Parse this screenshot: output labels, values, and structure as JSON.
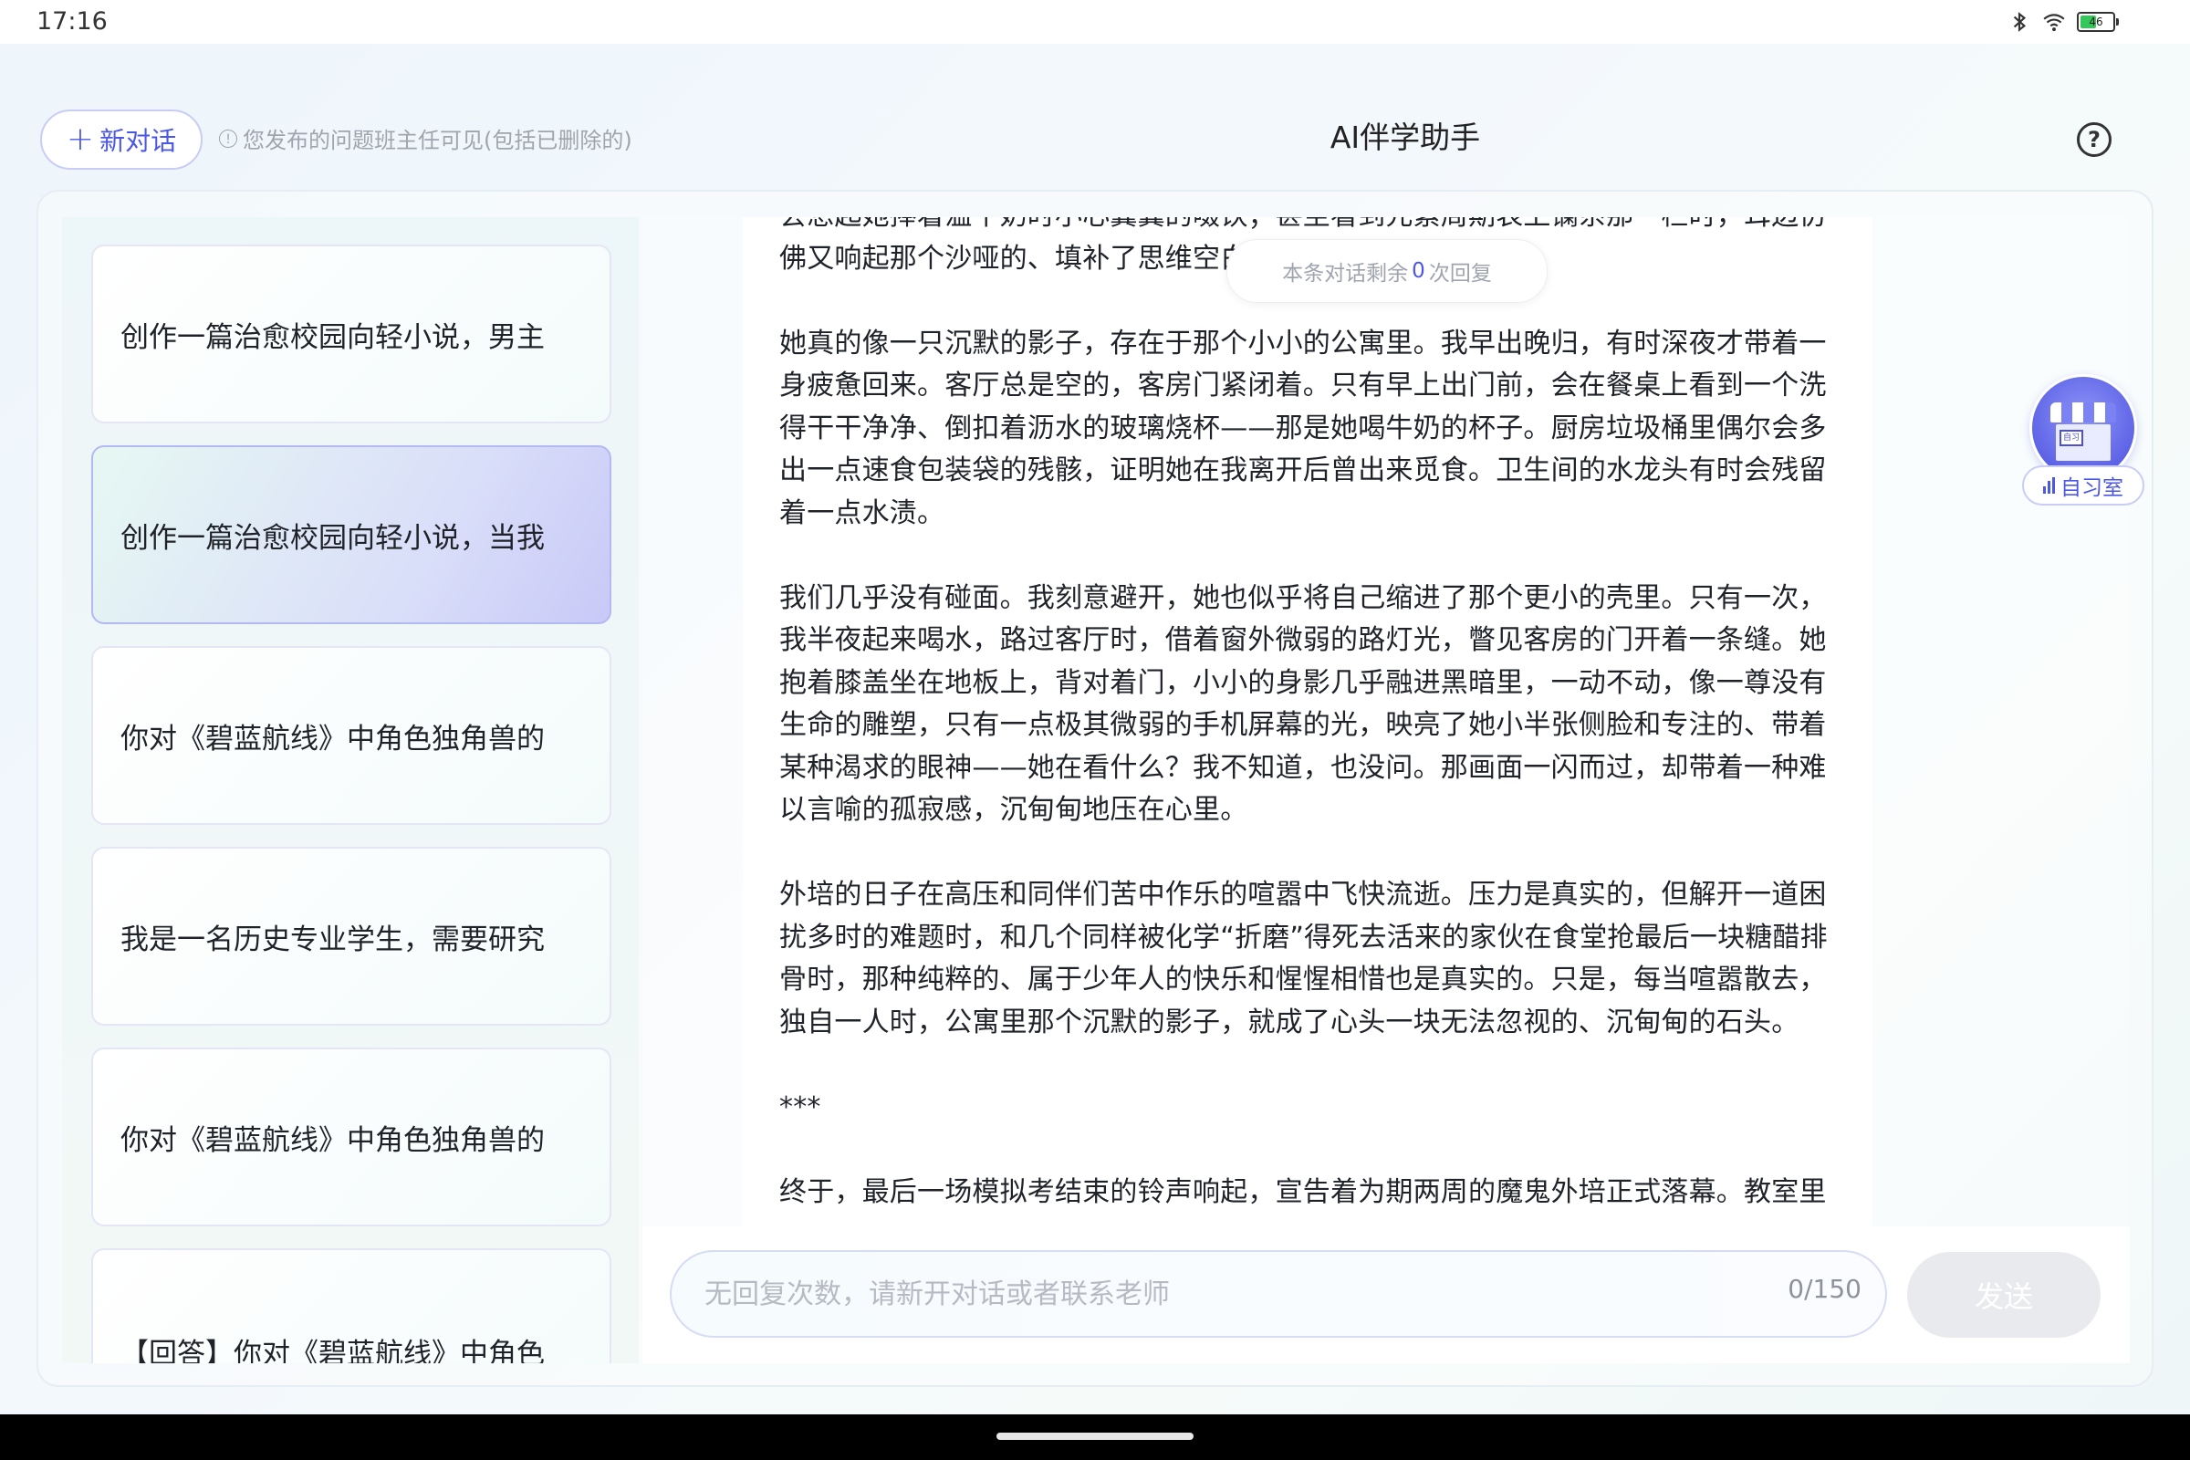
{
  "status_bar": {
    "time": "17:16",
    "battery_level": "46"
  },
  "header": {
    "new_chat_label": "新对话",
    "notice": "您发布的问题班主任可见(包括已删除的)",
    "title": "AI伴学助手"
  },
  "sidebar": {
    "items": [
      {
        "label": "创作一篇治愈校园向轻小说，男主",
        "active": false
      },
      {
        "label": "创作一篇治愈校园向轻小说，当我",
        "active": true
      },
      {
        "label": "你对《碧蓝航线》中角色独角兽的",
        "active": false
      },
      {
        "label": "我是一名历史专业学生，需要研究",
        "active": false
      },
      {
        "label": "你对《碧蓝航线》中角色独角兽的",
        "active": false
      },
      {
        "label": "【回答】你对《碧蓝航线》中角色",
        "active": false
      }
    ]
  },
  "chat": {
    "remaining_prefix": "本条对话剩余",
    "remaining_count": "0",
    "remaining_suffix": "次回复",
    "paragraphs": [
      "会想起她捧着温牛奶时小心翼翼的啜饮；甚至看到元素周期表上镧系那一栏时，耳边仿佛又响起那个沙哑的、填补了思维空白",
      "她真的像一只沉默的影子，存在于那个小小的公寓里。我早出晚归，有时深夜才带着一身疲惫回来。客厅总是空的，客房门紧闭着。只有早上出门前，会在餐桌上看到一个洗得干干净净、倒扣着沥水的玻璃烧杯——那是她喝牛奶的杯子。厨房垃圾桶里偶尔会多出一点速食包装袋的残骸，证明她在我离开后曾出来觅食。卫生间的水龙头有时会残留着一点水渍。",
      "我们几乎没有碰面。我刻意避开，她也似乎将自己缩进了那个更小的壳里。只有一次，我半夜起来喝水，路过客厅时，借着窗外微弱的路灯光，瞥见客房的门开着一条缝。她抱着膝盖坐在地板上，背对着门，小小的身影几乎融进黑暗里，一动不动，像一尊没有生命的雕塑，只有一点极其微弱的手机屏幕的光，映亮了她小半张侧脸和专注的、带着某种渴求的眼神——她在看什么？我不知道，也没问。那画面一闪而过，却带着一种难以言喻的孤寂感，沉甸甸地压在心里。",
      "外培的日子在高压和同伴们苦中作乐的喧嚣中飞快流逝。压力是真实的，但解开一道困扰多时的难题时，和几个同样被化学“折磨”得死去活来的家伙在食堂抢最后一块糖醋排骨时，那种纯粹的、属于少年人的快乐和惺惺相惜也是真实的。只是，每当喧嚣散去，独自一人时，公寓里那个沉默的影子，就成了心头一块无法忽视的、沉甸甸的石头。",
      "***",
      "终于，最后一场模拟考结束的铃声响起，宣告着为期两周的魔鬼外培正式落幕。教室里"
    ]
  },
  "input": {
    "placeholder": "无回复次数，请新开对话或者联系老师",
    "counter": "0/150",
    "send_label": "发送"
  },
  "study_room": {
    "label": "自习室",
    "sign": "自习"
  },
  "colors": {
    "accent": "#4b57e6",
    "active_item_gradient_end": "#c8c9f7",
    "muted_text": "#a0a4ae"
  }
}
